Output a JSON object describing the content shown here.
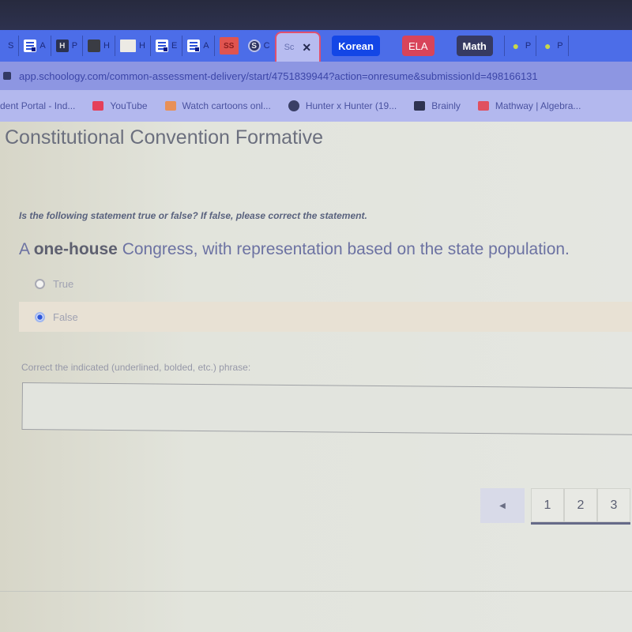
{
  "browser": {
    "tabs": [
      {
        "icon": "generic-tab-icon",
        "label": "S"
      },
      {
        "icon": "google-docs-icon",
        "label": "A"
      },
      {
        "icon": "h-icon",
        "label": "P"
      },
      {
        "icon": "image-icon",
        "label": "H"
      },
      {
        "icon": "card-icon",
        "label": "H"
      },
      {
        "icon": "google-docs-icon",
        "label": "E"
      },
      {
        "icon": "google-docs-icon",
        "label": "A"
      },
      {
        "icon": "ss-icon",
        "label": "SS"
      },
      {
        "icon": "schoology-icon",
        "label": "C"
      }
    ],
    "active_tab": {
      "label": "Sc",
      "close": "✕"
    },
    "tab_groups": [
      {
        "label": "Korean",
        "color": "#1346e6"
      },
      {
        "label": "ELA",
        "color": "#d8445a"
      },
      {
        "label": "Math",
        "color": "#363a62"
      }
    ],
    "trailing_tabs": [
      {
        "icon": "pear-icon",
        "label": "P"
      },
      {
        "icon": "pear-icon",
        "label": "P"
      }
    ],
    "url": "app.schoology.com/common-assessment-delivery/start/4751839944?action=onresume&submissionId=498166131"
  },
  "bookmarks": [
    {
      "icon": "none",
      "label": "dent Portal - Ind..."
    },
    {
      "icon": "youtube-icon",
      "label": "YouTube"
    },
    {
      "icon": "cartoons-icon",
      "label": "Watch cartoons onl..."
    },
    {
      "icon": "globe-icon",
      "label": "Hunter x Hunter (19..."
    },
    {
      "icon": "brainly-icon",
      "label": "Brainly"
    },
    {
      "icon": "mathway-icon",
      "label": "Mathway | Algebra..."
    }
  ],
  "assessment": {
    "title": "Constitutional Convention Formative",
    "instructions": "Is the following statement true or false? If false, please correct the statement.",
    "statement_bold": "A one-house",
    "statement_bold_word": "one-house",
    "statement_prefix": "A ",
    "statement_rest": " Congress, with representation based on the state population.",
    "options": [
      {
        "label": "True",
        "selected": false
      },
      {
        "label": "False",
        "selected": true
      }
    ],
    "correction_label": "Correct the indicated (underlined, bolded, etc.) phrase:",
    "correction_value": ""
  },
  "pagination": {
    "prev": "◀",
    "pages": [
      "1",
      "2",
      "3"
    ],
    "current": "1"
  }
}
